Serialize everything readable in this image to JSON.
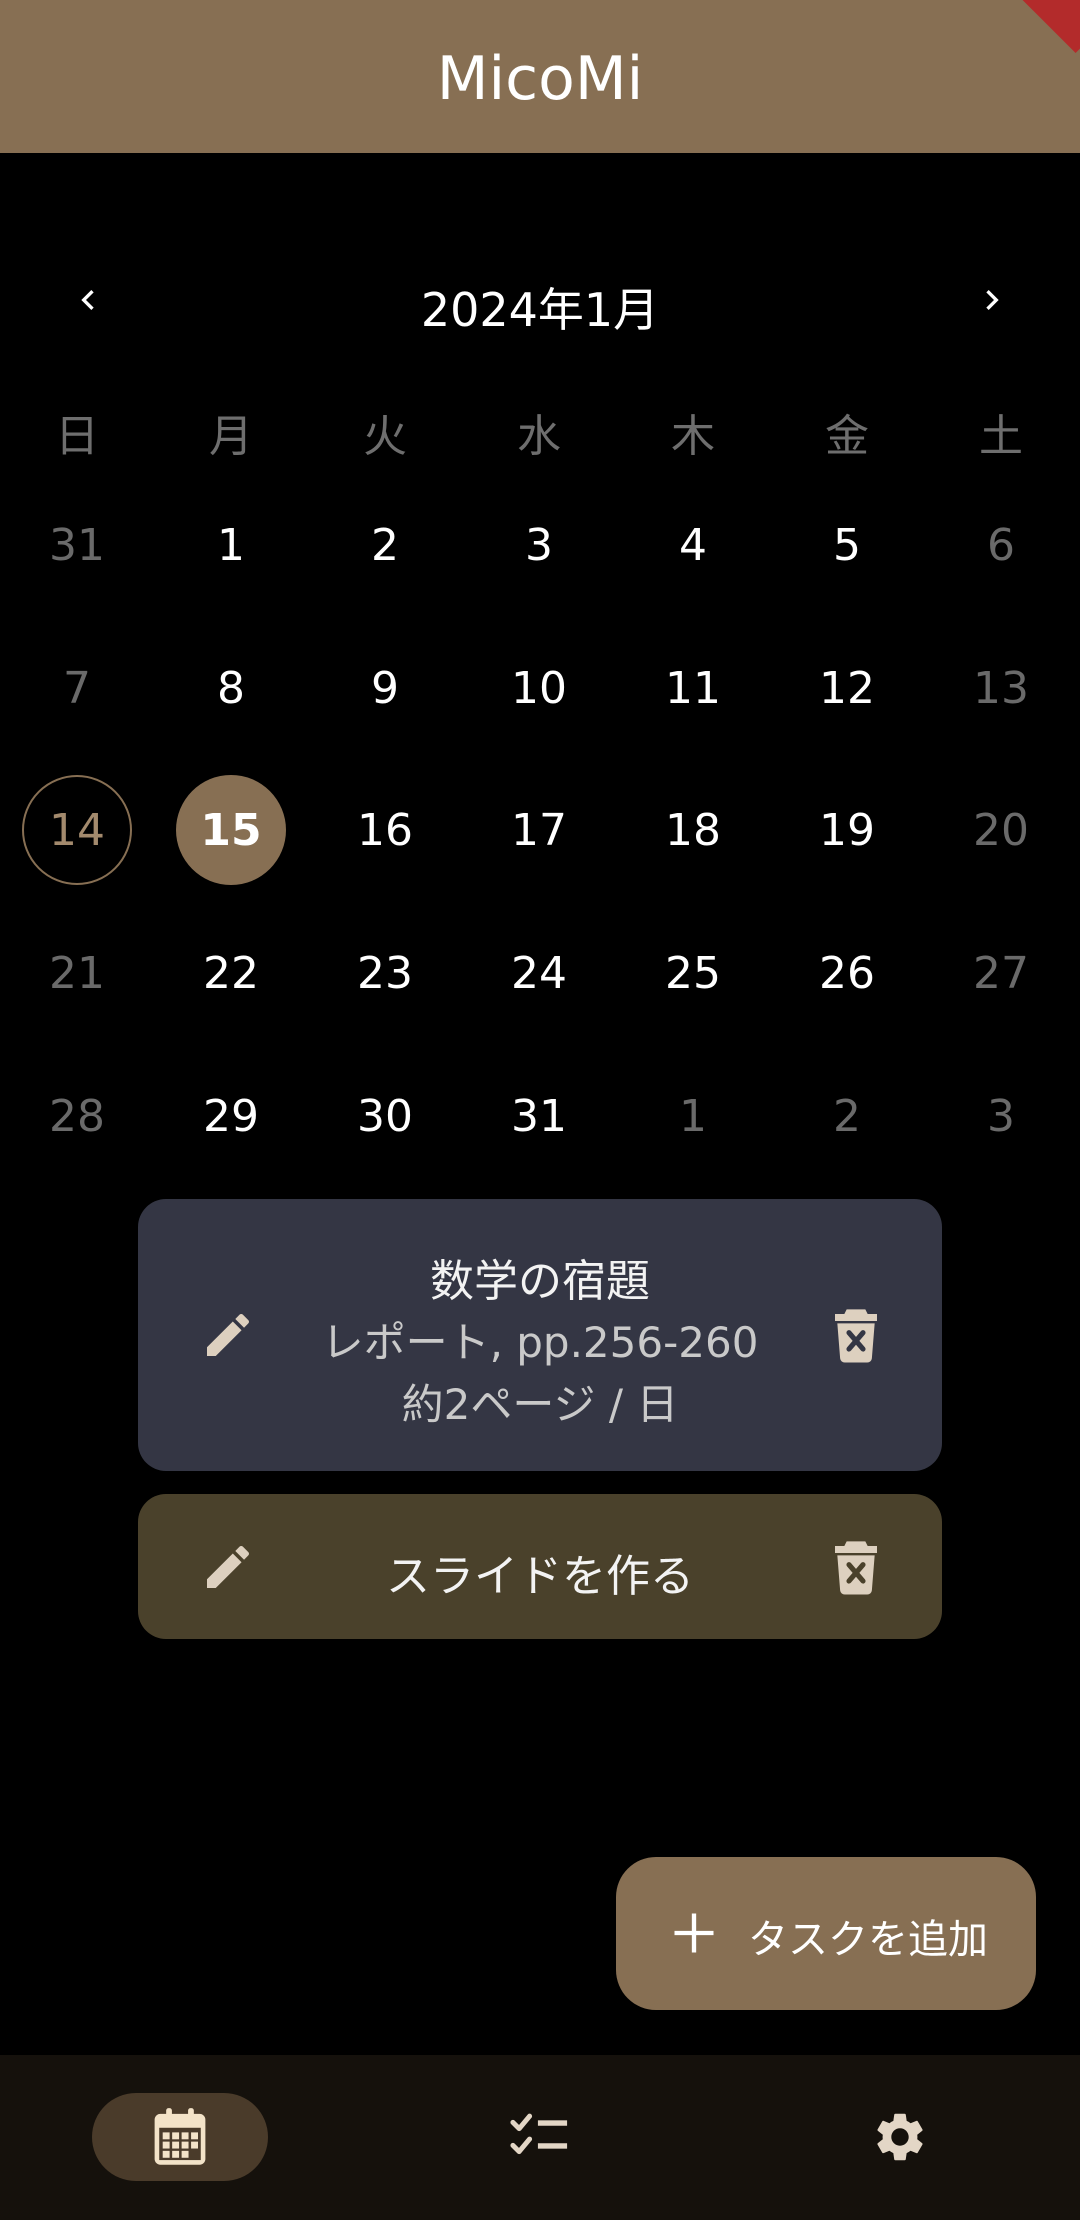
{
  "app": {
    "title": "MicoMi"
  },
  "calendar": {
    "month_label": "2024年1月",
    "weekdays": [
      "日",
      "月",
      "火",
      "水",
      "木",
      "金",
      "土"
    ],
    "weeks": [
      [
        "31",
        "1",
        "2",
        "3",
        "4",
        "5",
        "6"
      ],
      [
        "7",
        "8",
        "9",
        "10",
        "11",
        "12",
        "13"
      ],
      [
        "14",
        "15",
        "16",
        "17",
        "18",
        "19",
        "20"
      ],
      [
        "21",
        "22",
        "23",
        "24",
        "25",
        "26",
        "27"
      ],
      [
        "28",
        "29",
        "30",
        "31",
        "1",
        "2",
        "3"
      ]
    ],
    "today": "14",
    "selected": "15"
  },
  "tasks": [
    {
      "title": "数学の宿題",
      "subtitle": "レポート, pp.256-260",
      "rate": "約2ページ / 日"
    },
    {
      "title": "スライドを作る"
    }
  ],
  "fab": {
    "label": "タスクを追加"
  },
  "bottom_nav": {
    "items": [
      {
        "icon": "calendar-icon",
        "active": true
      },
      {
        "icon": "checklist-icon",
        "active": false
      },
      {
        "icon": "gear-icon",
        "active": false
      }
    ]
  },
  "colors": {
    "accent": "#876f53",
    "task_card_1": "#343644",
    "task_card_2": "#4a412b",
    "nav_background": "#15110c"
  }
}
